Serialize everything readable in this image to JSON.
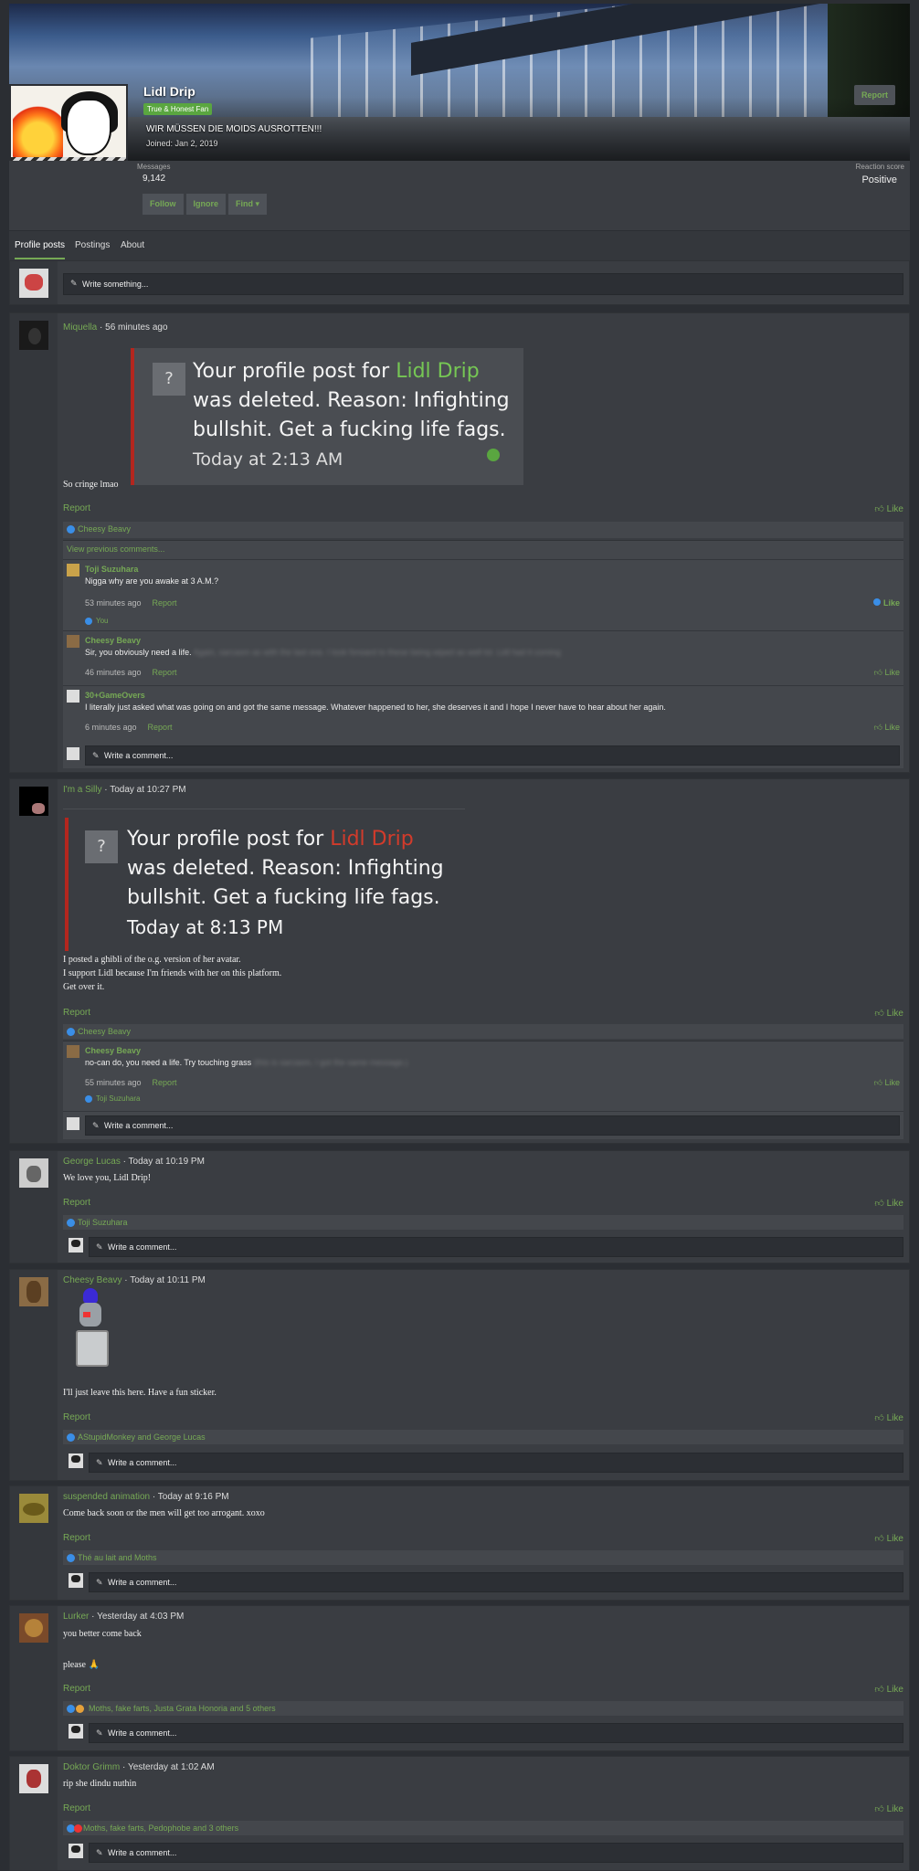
{
  "profile": {
    "name": "Lidl Drip",
    "badge": "True & Honest Fan",
    "title": "WIR MÜSSEN DIE MOIDS AUSROTTEN!!!",
    "joined": "Joined: Jan 2, 2019",
    "report": "Report",
    "messages_label": "Messages",
    "messages": "9,142",
    "reaction_label": "Reaction score",
    "reaction": "Positive",
    "actions": [
      "Follow",
      "Ignore",
      "Find ▾"
    ]
  },
  "tabs": [
    "Profile posts",
    "Postings",
    "About"
  ],
  "write_something": "Write something...",
  "write_comment": "Write a comment...",
  "report": "Report",
  "like": "Like",
  "posts": [
    {
      "user": "Miquella",
      "time": "56 minutes ago",
      "notice": {
        "prefix": "Your profile post for ",
        "name": "Lidl Drip",
        "text": "\nwas deleted. Reason: Infighting\nbullshit. Get a fucking life fags.",
        "time": "Today at 2:13 AM",
        "name_color": "#76c754"
      },
      "text": "So cringe lmao",
      "reactions": "Cheesy Beavy",
      "prev": "View previous comments...",
      "comments": [
        {
          "user": "Toji Suzuhara",
          "text": "Nigga why are you awake at 3 A.M.?",
          "blur": "",
          "time": "53 minutes ago",
          "react": "You",
          "liked": true
        },
        {
          "user": "Cheesy Beavy",
          "text": "Sir, you obviously need a life. ",
          "blur": "Again, sarcasm as with the last one. I look forward to these being wiped as well lol. Lidl had it coming",
          "time": "46 minutes ago",
          "react": "",
          "liked": false
        },
        {
          "user": "30+GameOvers",
          "text": "I literally just asked what was going on and got the same message. Whatever happened to her, she deserves it and I hope I never have to hear about her again.",
          "blur": "",
          "time": "6 minutes ago",
          "react": "",
          "liked": false
        }
      ]
    },
    {
      "user": "I'm a Silly",
      "time": "Today at 10:27 PM",
      "notice": {
        "prefix": "Your profile post for ",
        "name": "Lidl Drip",
        "text": "\nwas deleted. Reason: Infighting\nbullshit. Get a fucking life fags.",
        "time": "Today at 8:13 PM",
        "name_color": "#d23b2b"
      },
      "text": "I posted a ghibli of the o.g. version of her avatar.\nI support Lidl because I'm friends with her on this platform.\nGet over it.",
      "reactions": "Cheesy Beavy",
      "comments": [
        {
          "user": "Cheesy Beavy",
          "text": "no-can do, you need a life. Try touching grass ",
          "blur": "(this is sarcasm, I got the same message.)",
          "time": "55 minutes ago",
          "react": "Toji Suzuhara",
          "liked": false
        }
      ]
    },
    {
      "user": "George Lucas",
      "time": "Today at 10:19 PM",
      "text": "We love you, Lidl Drip!",
      "reactions": "Toji Suzuhara"
    },
    {
      "user": "Cheesy Beavy",
      "time": "Today at 10:11 PM",
      "text": "I'll just leave this here. Have a fun sticker.",
      "reactions": "AStupidMonkey and George Lucas"
    },
    {
      "user": "suspended animation",
      "time": "Today at 9:16 PM",
      "text": "Come back soon or the men will get too arrogant. xoxo",
      "reactions": "Thé au lait and Moths"
    },
    {
      "user": "Lurker",
      "time": "Yesterday at 4:03 PM",
      "text": "you better come back\n\nplease 🙏",
      "reactions": "Moths, fake farts, Justa Grata Honoria and 5 others"
    },
    {
      "user": "Doktor Grimm",
      "time": "Yesterday at 1:02 AM",
      "text": "rip she dindu nuthin",
      "reactions": "Moths, fake farts, Pedophobe and 3 others"
    }
  ]
}
